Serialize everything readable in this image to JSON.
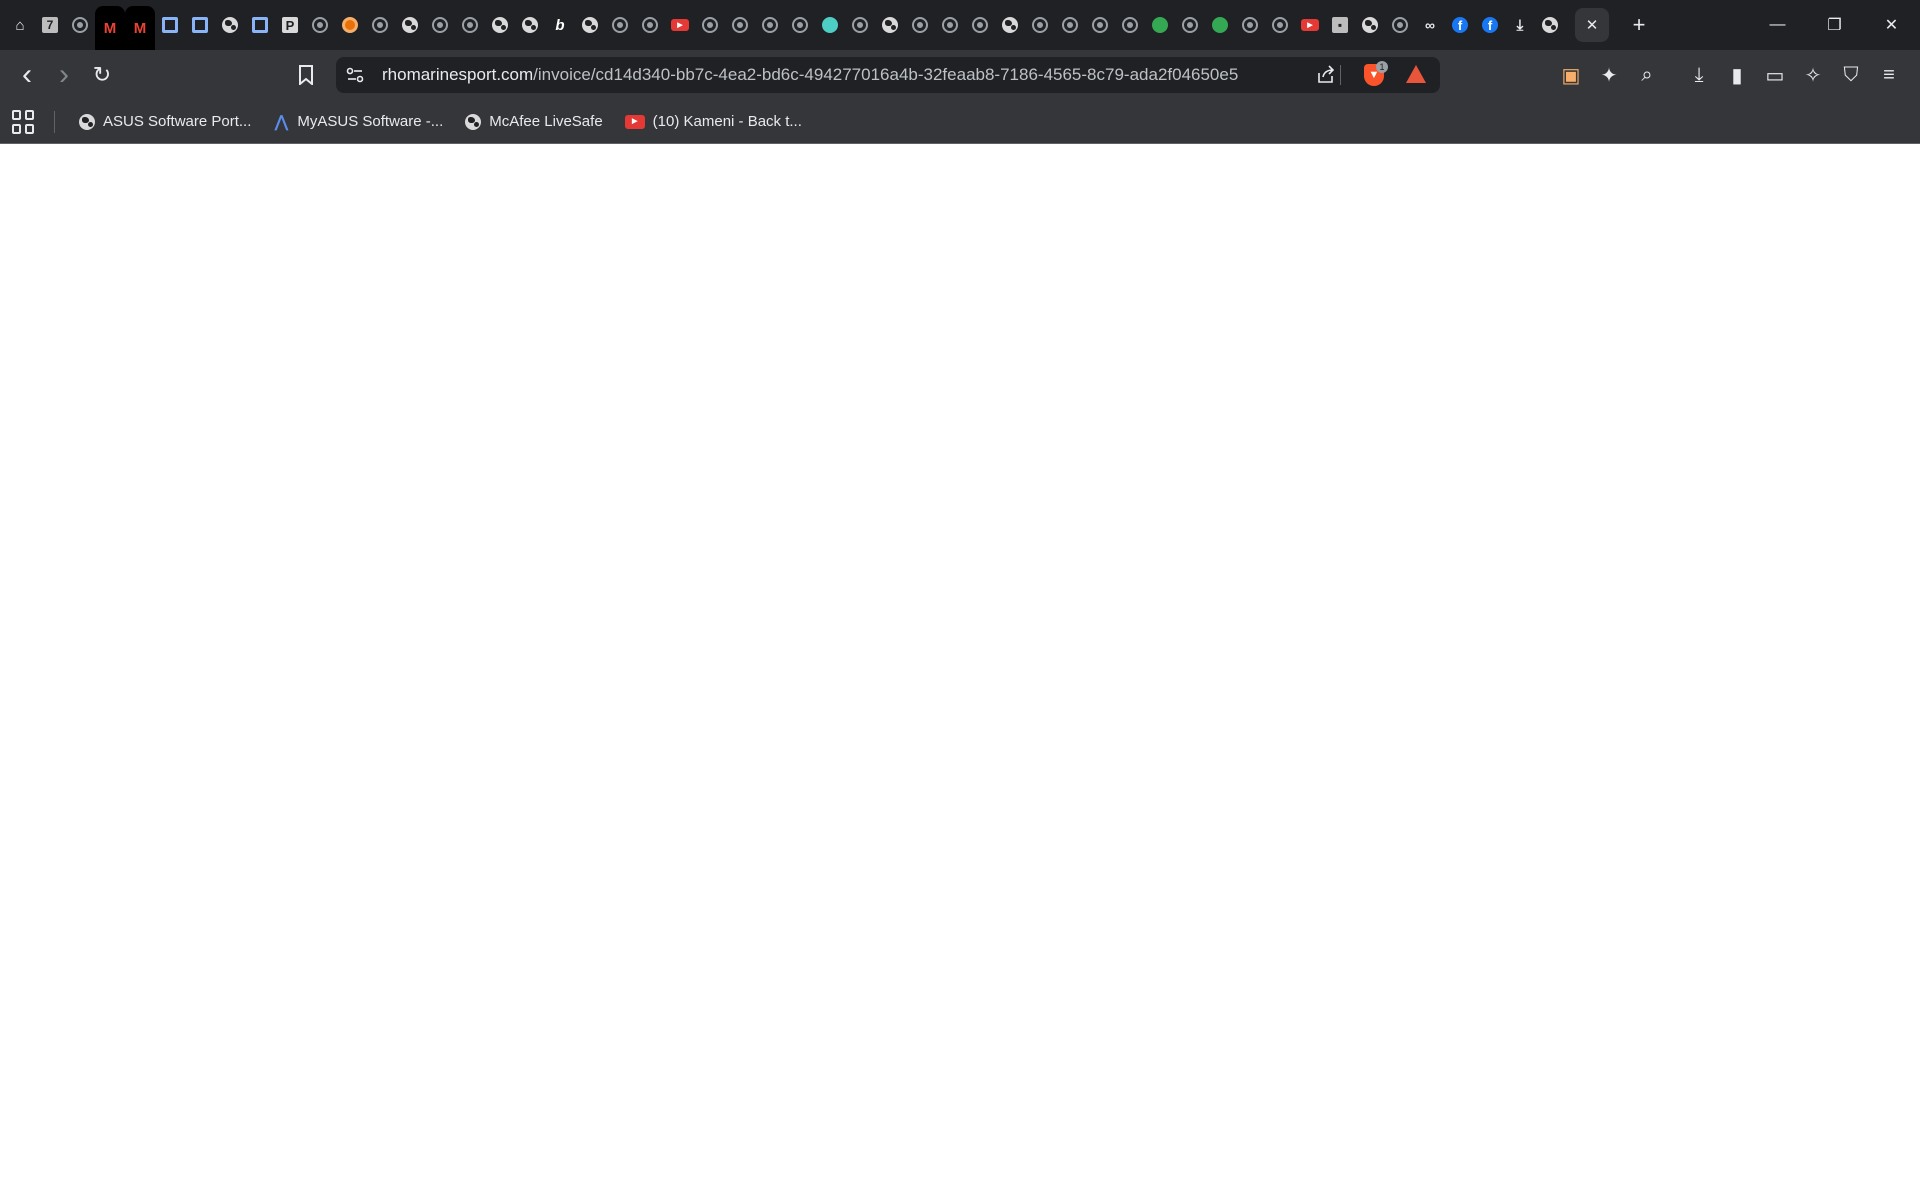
{
  "tabs": {
    "pinned": [
      {
        "icon": "home-icon",
        "glyph": "⌂"
      },
      {
        "icon": "seven-icon",
        "glyph": "7"
      },
      {
        "icon": "ring-icon",
        "glyph": ""
      },
      {
        "icon": "gmail-icon",
        "glyph": "M"
      },
      {
        "icon": "gmail-icon",
        "glyph": "M"
      },
      {
        "icon": "blue-square-icon",
        "glyph": ""
      },
      {
        "icon": "blue-square-icon",
        "glyph": ""
      },
      {
        "icon": "globe-icon",
        "glyph": ""
      },
      {
        "icon": "blue-square-icon",
        "glyph": ""
      },
      {
        "icon": "p-icon",
        "glyph": "P"
      },
      {
        "icon": "ring-icon",
        "glyph": ""
      },
      {
        "icon": "orange-circle-icon",
        "glyph": ""
      },
      {
        "icon": "ring-icon",
        "glyph": ""
      },
      {
        "icon": "globe-icon",
        "glyph": ""
      },
      {
        "icon": "ring-icon",
        "glyph": ""
      },
      {
        "icon": "ring-icon",
        "glyph": ""
      },
      {
        "icon": "globe-icon",
        "glyph": ""
      },
      {
        "icon": "globe-icon",
        "glyph": ""
      },
      {
        "icon": "b-icon",
        "glyph": "b"
      },
      {
        "icon": "globe-icon",
        "glyph": ""
      },
      {
        "icon": "ring-icon",
        "glyph": ""
      },
      {
        "icon": "ring-icon",
        "glyph": ""
      },
      {
        "icon": "youtube-icon",
        "glyph": "▶"
      },
      {
        "icon": "ring-icon",
        "glyph": ""
      },
      {
        "icon": "ring-icon",
        "glyph": ""
      },
      {
        "icon": "ring-icon",
        "glyph": ""
      },
      {
        "icon": "ring-icon",
        "glyph": ""
      },
      {
        "icon": "teal-circle-icon",
        "glyph": ""
      },
      {
        "icon": "ring-icon",
        "glyph": ""
      },
      {
        "icon": "globe-icon",
        "glyph": ""
      },
      {
        "icon": "ring-icon",
        "glyph": ""
      },
      {
        "icon": "ring-icon",
        "glyph": ""
      },
      {
        "icon": "ring-icon",
        "glyph": ""
      },
      {
        "icon": "globe-icon",
        "glyph": ""
      },
      {
        "icon": "ring-icon",
        "glyph": ""
      },
      {
        "icon": "ring-icon",
        "glyph": ""
      },
      {
        "icon": "ring-icon",
        "glyph": ""
      },
      {
        "icon": "ring-icon",
        "glyph": ""
      },
      {
        "icon": "green-circle-icon",
        "glyph": ""
      },
      {
        "icon": "ring-icon",
        "glyph": ""
      },
      {
        "icon": "green-circle-icon",
        "glyph": ""
      },
      {
        "icon": "ring-icon",
        "glyph": ""
      },
      {
        "icon": "ring-icon",
        "glyph": ""
      },
      {
        "icon": "youtube-icon",
        "glyph": "▶"
      },
      {
        "icon": "seven-icon",
        "glyph": "▪"
      },
      {
        "icon": "globe-icon",
        "glyph": ""
      },
      {
        "icon": "ring-icon",
        "glyph": ""
      },
      {
        "icon": "meta-icon",
        "glyph": "∞"
      },
      {
        "icon": "facebook-icon",
        "glyph": "f"
      },
      {
        "icon": "facebook-icon",
        "glyph": "f"
      },
      {
        "icon": "download-icon",
        "glyph": "⤓"
      },
      {
        "icon": "globe-icon",
        "glyph": ""
      }
    ],
    "current_close_glyph": "✕",
    "new_tab_glyph": "+"
  },
  "window": {
    "minimize_glyph": "—",
    "restore_glyph": "❐",
    "close_glyph": "✕"
  },
  "toolbar": {
    "back_glyph": "‹",
    "forward_glyph": "›",
    "reload_glyph": "↻",
    "bookmark_glyph": "🔖",
    "site_info_glyph": "⚙",
    "url_domain": "rhomarinesport.com",
    "url_path": "/invoice/cd14d340-bb7c-4ea2-bd6c-494277016a4b-32feaab8-7186-4565-8c79-ada2f04650e5",
    "share_glyph": "⇪",
    "shield_count": "1",
    "right_icons": [
      {
        "name": "rewards-wallet-icon",
        "glyph": "▣"
      },
      {
        "name": "extensions-icon",
        "glyph": "✦"
      },
      {
        "name": "search-tab-icon",
        "glyph": "⌕"
      },
      {
        "name": "downloads-icon",
        "glyph": "⤓"
      },
      {
        "name": "sidebar-icon",
        "glyph": "▮"
      },
      {
        "name": "wallet-icon",
        "glyph": "▭"
      },
      {
        "name": "leo-ai-icon",
        "glyph": "✧"
      },
      {
        "name": "vpn-icon",
        "glyph": "⛉"
      },
      {
        "name": "menu-icon",
        "glyph": "≡"
      }
    ]
  },
  "bookmarks": [
    {
      "label": "ASUS Software Port...",
      "icon": "globe-icon"
    },
    {
      "label": "MyASUS Software -...",
      "icon": "myasus-icon"
    },
    {
      "label": "McAfee LiveSafe",
      "icon": "globe-icon"
    },
    {
      "label": "(10) Kameni - Back t...",
      "icon": "youtube-icon"
    }
  ]
}
